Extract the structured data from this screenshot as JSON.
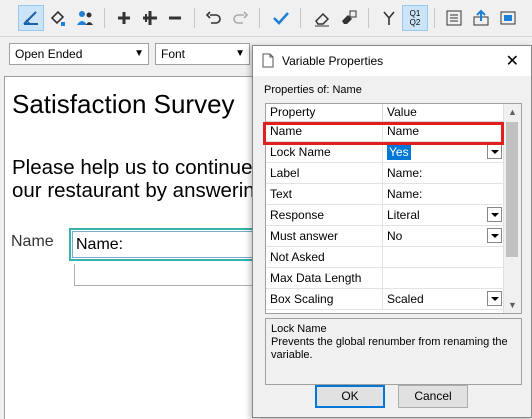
{
  "toolbar": {
    "buttons": [
      {
        "name": "select-tool-icon"
      },
      {
        "name": "fill-format-icon"
      },
      {
        "name": "people-icon"
      },
      {
        "name": "add-icon"
      },
      {
        "name": "add-multiple-icon"
      },
      {
        "name": "remove-icon"
      },
      {
        "name": "undo-icon"
      },
      {
        "name": "redo-icon"
      },
      {
        "name": "check-icon"
      },
      {
        "name": "erase-icon"
      },
      {
        "name": "eraser-multi-icon"
      },
      {
        "name": "branch-icon"
      },
      {
        "name": "question-order-icon",
        "label_top": "Q1",
        "label_bottom": "Q2"
      },
      {
        "name": "list-icon"
      },
      {
        "name": "upload-icon"
      },
      {
        "name": "export-icon"
      }
    ]
  },
  "format": {
    "question_type": "Open Ended",
    "font": "Font"
  },
  "survey": {
    "title": "Satisfaction Survey",
    "line1": "Please help us to continue",
    "line2": "our restaurant by answering",
    "question_label": "Name",
    "answer_text": "Name:"
  },
  "dialog": {
    "title": "Variable Properties",
    "close": "✕",
    "properties_of": "Properties of: Name",
    "header_property": "Property",
    "header_value": "Value",
    "rows": [
      {
        "property": "Name",
        "value": "Name",
        "dropdown": false
      },
      {
        "property": "Lock Name",
        "value": "Yes",
        "dropdown": true,
        "selected": true
      },
      {
        "property": "Label",
        "value": "Name:",
        "dropdown": false
      },
      {
        "property": "Text",
        "value": "Name:",
        "dropdown": false
      },
      {
        "property": "Response",
        "value": "Literal",
        "dropdown": true
      },
      {
        "property": "Must answer",
        "value": "No",
        "dropdown": true
      },
      {
        "property": "Not Asked",
        "value": "",
        "dropdown": false
      },
      {
        "property": "Max Data Length",
        "value": "",
        "dropdown": false
      },
      {
        "property": "Box Scaling",
        "value": "Scaled",
        "dropdown": true
      }
    ],
    "description_title": "Lock Name",
    "description_text": "Prevents the global renumber from renaming the variable.",
    "ok_label": "OK",
    "cancel_label": "Cancel"
  },
  "colors": {
    "highlight": "#e0201f",
    "selection": "#0078d7",
    "question_border": "#38b2ac"
  }
}
